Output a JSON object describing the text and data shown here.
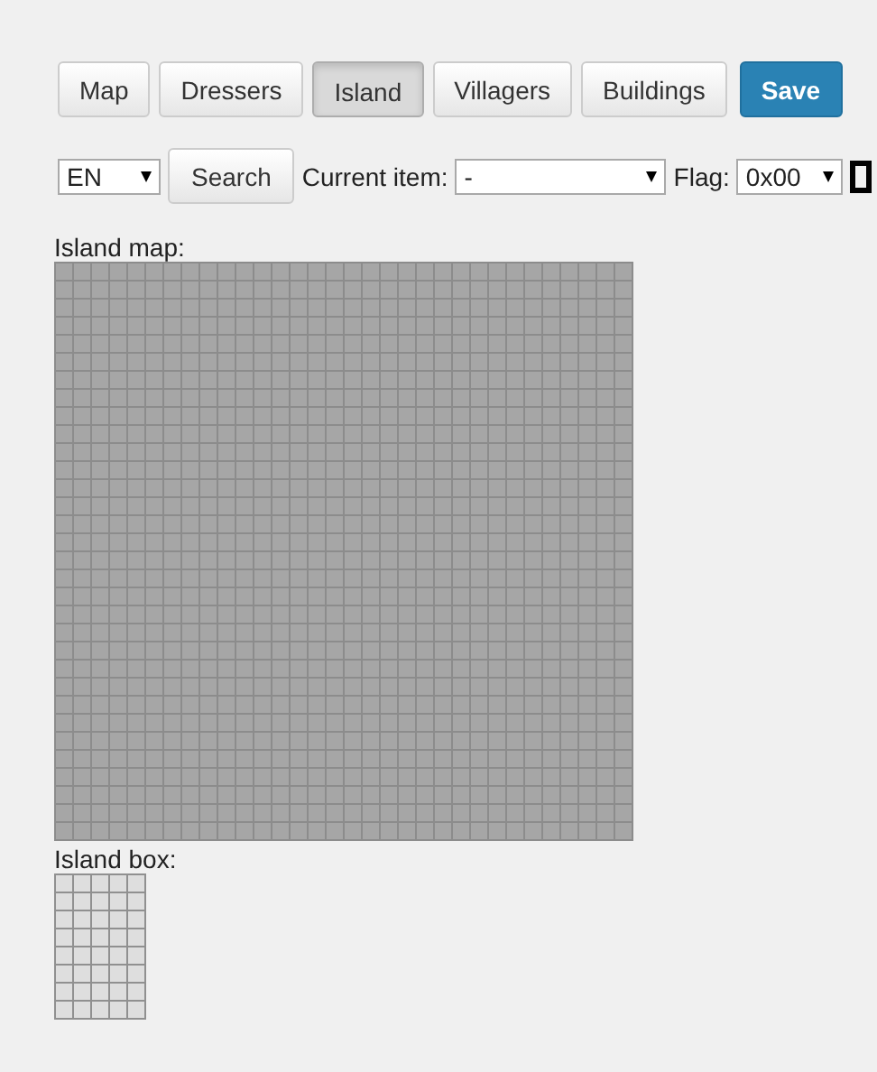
{
  "tabs": [
    {
      "label": "Map",
      "selected": false
    },
    {
      "label": "Dressers",
      "selected": false
    },
    {
      "label": "Island",
      "selected": true
    },
    {
      "label": "Villagers",
      "selected": false
    },
    {
      "label": "Buildings",
      "selected": false
    }
  ],
  "save_button": "Save",
  "language_select": {
    "value": "EN"
  },
  "search_button": "Search",
  "current_item": {
    "label": "Current item:",
    "value": "-"
  },
  "flag": {
    "label": "Flag:",
    "value": "0x00"
  },
  "island_map": {
    "label": "Island map:"
  },
  "island_box": {
    "label": "Island box:"
  }
}
